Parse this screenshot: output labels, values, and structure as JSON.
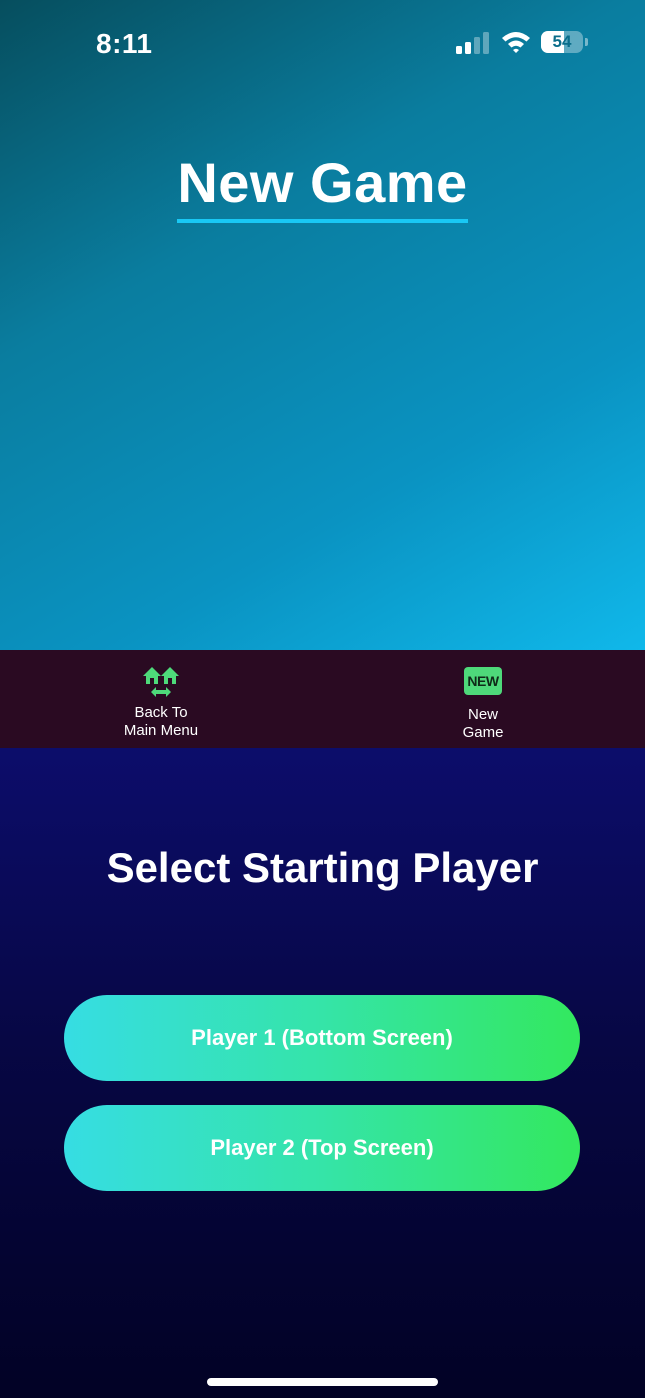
{
  "status_bar": {
    "time": "8:11",
    "battery_level": "54",
    "battery_fraction": 0.54,
    "signal_bars_active": 2,
    "icons": [
      "cellular-signal-icon",
      "wifi-icon",
      "battery-icon"
    ]
  },
  "header": {
    "title": "New Game",
    "underline_color": "#19c8f5"
  },
  "toolbar": {
    "back_label": "Back To\nMain Menu",
    "back_icon": "home-swap-icon",
    "new_label": "New\nGame",
    "new_badge_text": "NEW",
    "new_icon": "new-badge-icon",
    "accent_color": "#4ed97a"
  },
  "main": {
    "title": "Select Starting Player",
    "buttons": [
      {
        "label": "Player 1 (Bottom Screen)"
      },
      {
        "label": "Player 2 (Top Screen)"
      }
    ],
    "button_gradient": [
      "#36dde3",
      "#33e85e"
    ]
  }
}
